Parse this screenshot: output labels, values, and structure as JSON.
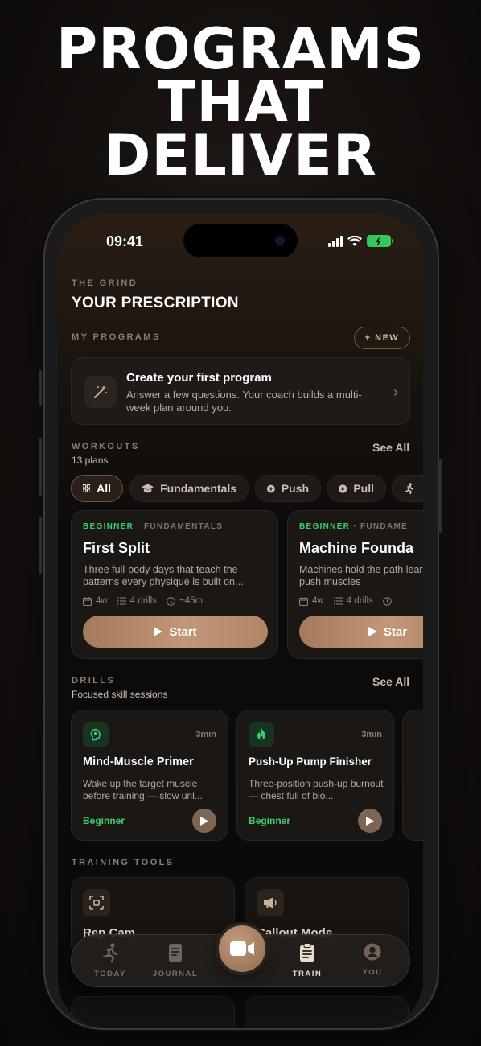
{
  "headline": {
    "line1": "PROGRAMS",
    "line2": "THAT",
    "line3": "DELIVER"
  },
  "status_bar": {
    "time": "09:41"
  },
  "header": {
    "eyebrow": "THE GRIND",
    "title": "YOUR PRESCRIPTION"
  },
  "my_programs": {
    "label": "MY PROGRAMS",
    "new_button": "+ NEW",
    "create_card": {
      "title": "Create your first program",
      "description": "Answer a few questions. Your coach builds a multi-week plan around you."
    }
  },
  "workouts": {
    "label": "WORKOUTS",
    "count": "13 plans",
    "see_all": "See All",
    "chips": [
      {
        "label": "All",
        "icon": "grid-icon"
      },
      {
        "label": "Fundamentals",
        "icon": "graduation-cap-icon"
      },
      {
        "label": "Push",
        "icon": "arrow-up-circle-icon"
      },
      {
        "label": "Pull",
        "icon": "arrow-down-circle-icon"
      },
      {
        "label": "",
        "icon": "runner-icon"
      }
    ],
    "cards": [
      {
        "level": "BEGINNER",
        "category": "FUNDAMENTALS",
        "title": "First Split",
        "description": "Three full-body days that teach the patterns every physique is built on...",
        "weeks": "4w",
        "drills": "4 drills",
        "duration": "~45m",
        "start_label": "Start"
      },
      {
        "level": "BEGINNER",
        "category": "FUNDAME",
        "title": "Machine Founda",
        "description": "Machines hold the path learn to push muscles",
        "weeks": "4w",
        "drills": "4 drills",
        "duration": "",
        "start_label": "Star"
      }
    ]
  },
  "drills": {
    "label": "DRILLS",
    "subtitle": "Focused skill sessions",
    "see_all": "See All",
    "cards": [
      {
        "icon": "head-icon",
        "duration": "3min",
        "title": "Mind-Muscle Primer",
        "description": "Wake up the target muscle before training — slow unl...",
        "level": "Beginner"
      },
      {
        "icon": "flame-icon",
        "duration": "3min",
        "title": "Push-Up Pump Finisher",
        "description": "Three-position push-up burnout — chest full of blo...",
        "level": "Beginner"
      }
    ]
  },
  "training_tools": {
    "label": "TRAINING TOOLS",
    "cards": [
      {
        "icon": "scan-icon",
        "title": "Rep Cam"
      },
      {
        "icon": "megaphone-icon",
        "title": "Callout Mode"
      }
    ]
  },
  "tab_bar": {
    "today": "TODAY",
    "journal": "JOURNAL",
    "train": "TRAIN",
    "you": "YOU",
    "center_icon": "video-camera-icon"
  },
  "colors": {
    "accent": "#b48a6a",
    "beginner_green": "#3ecf6a",
    "battery_green": "#34c759"
  }
}
